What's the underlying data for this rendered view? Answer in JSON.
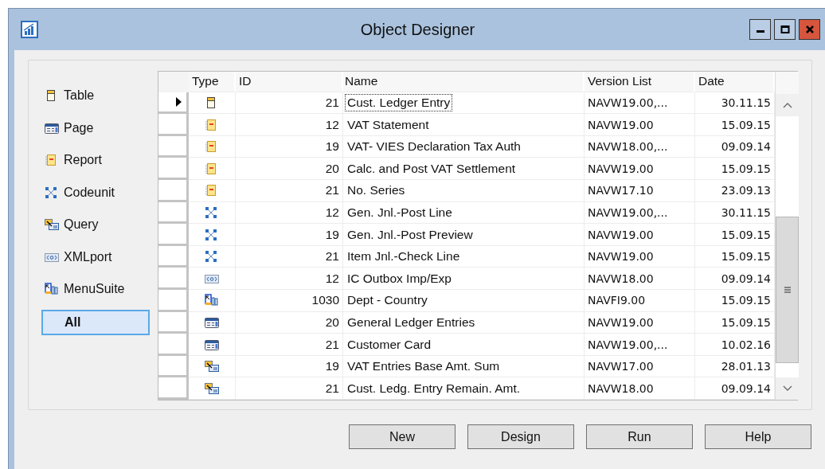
{
  "window": {
    "title": "Object Designer"
  },
  "sidebar": {
    "items": [
      {
        "kind": "table",
        "label": "Table",
        "selected": false
      },
      {
        "kind": "page",
        "label": "Page",
        "selected": false
      },
      {
        "kind": "report",
        "label": "Report",
        "selected": false
      },
      {
        "kind": "codeunit",
        "label": "Codeunit",
        "selected": false
      },
      {
        "kind": "query",
        "label": "Query",
        "selected": false
      },
      {
        "kind": "xmlport",
        "label": "XMLport",
        "selected": false
      },
      {
        "kind": "menusuite",
        "label": "MenuSuite",
        "selected": false
      },
      {
        "kind": "all",
        "label": "All",
        "selected": true
      }
    ]
  },
  "table": {
    "columns": [
      "Type",
      "ID",
      "Name",
      "Version List",
      "Date"
    ],
    "rows": [
      {
        "kind": "table",
        "id": "21",
        "name": "Cust. Ledger Entry",
        "version": "NAVW19.00,...",
        "date": "30.11.15",
        "current": true
      },
      {
        "kind": "report",
        "id": "12",
        "name": "VAT Statement",
        "version": "NAVW19.00",
        "date": "15.09.15",
        "current": false
      },
      {
        "kind": "report",
        "id": "19",
        "name": "VAT- VIES Declaration Tax Auth",
        "version": "NAVW18.00,...",
        "date": "09.09.14",
        "current": false
      },
      {
        "kind": "report",
        "id": "20",
        "name": "Calc. and Post VAT Settlement",
        "version": "NAVW19.00",
        "date": "15.09.15",
        "current": false
      },
      {
        "kind": "report",
        "id": "21",
        "name": "No. Series",
        "version": "NAVW17.10",
        "date": "23.09.13",
        "current": false
      },
      {
        "kind": "codeunit",
        "id": "12",
        "name": "Gen. Jnl.-Post Line",
        "version": "NAVW19.00,...",
        "date": "30.11.15",
        "current": false
      },
      {
        "kind": "codeunit",
        "id": "19",
        "name": "Gen. Jnl.-Post Preview",
        "version": "NAVW19.00",
        "date": "15.09.15",
        "current": false
      },
      {
        "kind": "codeunit",
        "id": "21",
        "name": "Item Jnl.-Check Line",
        "version": "NAVW19.00",
        "date": "15.09.15",
        "current": false
      },
      {
        "kind": "xmlport",
        "id": "12",
        "name": "IC Outbox Imp/Exp",
        "version": "NAVW18.00",
        "date": "09.09.14",
        "current": false
      },
      {
        "kind": "menusuite",
        "id": "1030",
        "name": "Dept - Country",
        "version": "NAVFI9.00",
        "date": "15.09.15",
        "current": false
      },
      {
        "kind": "page",
        "id": "20",
        "name": "General Ledger Entries",
        "version": "NAVW19.00",
        "date": "15.09.15",
        "current": false
      },
      {
        "kind": "page",
        "id": "21",
        "name": "Customer Card",
        "version": "NAVW19.00,...",
        "date": "10.02.16",
        "current": false
      },
      {
        "kind": "query",
        "id": "19",
        "name": "VAT Entries Base Amt. Sum",
        "version": "NAVW17.00",
        "date": "28.01.13",
        "current": false
      },
      {
        "kind": "query",
        "id": "21",
        "name": "Cust. Ledg. Entry Remain. Amt.",
        "version": "NAVW18.00",
        "date": "09.09.14",
        "current": false
      }
    ]
  },
  "buttons": [
    "New",
    "Design",
    "Run",
    "Help"
  ]
}
